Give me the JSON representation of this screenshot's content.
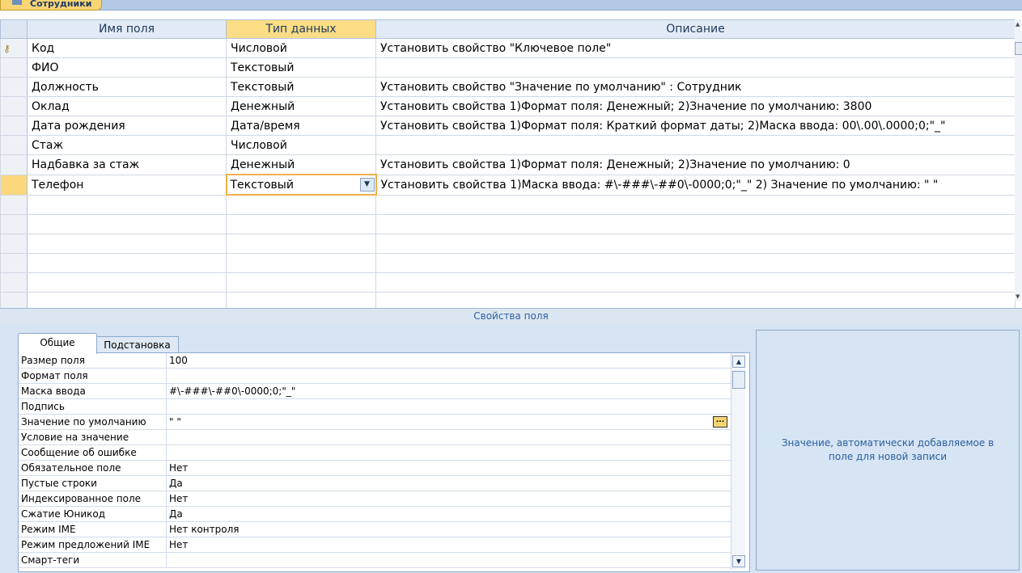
{
  "document_tab": {
    "label": "Сотрудники"
  },
  "grid": {
    "headers": [
      "Имя поля",
      "Тип данных",
      "Описание"
    ],
    "rows": [
      {
        "name": "Код",
        "type": "Числовой",
        "desc": "Установить свойство \"Ключевое поле\""
      },
      {
        "name": "ФИО",
        "type": "Текстовый",
        "desc": ""
      },
      {
        "name": "Должность",
        "type": "Текстовый",
        "desc": "Установить свойство \"Значение по умолчанию\" : Сотрудник"
      },
      {
        "name": "Оклад",
        "type": "Денежный",
        "desc": "Установить свойства 1)Формат поля:  Денежный;  2)Значение по умолчанию: 3800"
      },
      {
        "name": "Дата рождения",
        "type": "Дата/время",
        "desc": "Установить свойства 1)Формат поля: Краткий формат даты;  2)Маска ввода: 00\\.00\\.0000;0;\"_\""
      },
      {
        "name": "Стаж",
        "type": "Числовой",
        "desc": ""
      },
      {
        "name": "Надбавка за стаж",
        "type": "Денежный",
        "desc": "Установить свойства 1)Формат поля:  Денежный;  2)Значение по умолчанию: 0"
      },
      {
        "name": "Телефон",
        "type": "Текстовый",
        "desc": "Установить свойства 1)Маска ввода: #\\-###\\-##0\\-0000;0;\"_\" 2) Значение по умолчанию: \" \""
      }
    ]
  },
  "field_properties": {
    "header": "Свойства поля",
    "tabs": [
      "Общие",
      "Подстановка"
    ],
    "rows": [
      {
        "key": "Размер поля",
        "value": "100"
      },
      {
        "key": "Формат поля",
        "value": ""
      },
      {
        "key": "Маска ввода",
        "value": "#\\-###\\-##0\\-0000;0;\"_\""
      },
      {
        "key": "Подпись",
        "value": ""
      },
      {
        "key": "Значение по умолчанию",
        "value": "\" \""
      },
      {
        "key": "Условие на значение",
        "value": ""
      },
      {
        "key": "Сообщение об ошибке",
        "value": ""
      },
      {
        "key": "Обязательное поле",
        "value": "Нет"
      },
      {
        "key": "Пустые строки",
        "value": "Да"
      },
      {
        "key": "Индексированное поле",
        "value": "Нет"
      },
      {
        "key": "Сжатие Юникод",
        "value": "Да"
      },
      {
        "key": "Режим IME",
        "value": "Нет контроля"
      },
      {
        "key": "Режим предложений IME",
        "value": "Нет"
      },
      {
        "key": "Смарт-теги",
        "value": ""
      }
    ],
    "help_text": "Значение, автоматически добавляемое в поле для новой записи"
  }
}
